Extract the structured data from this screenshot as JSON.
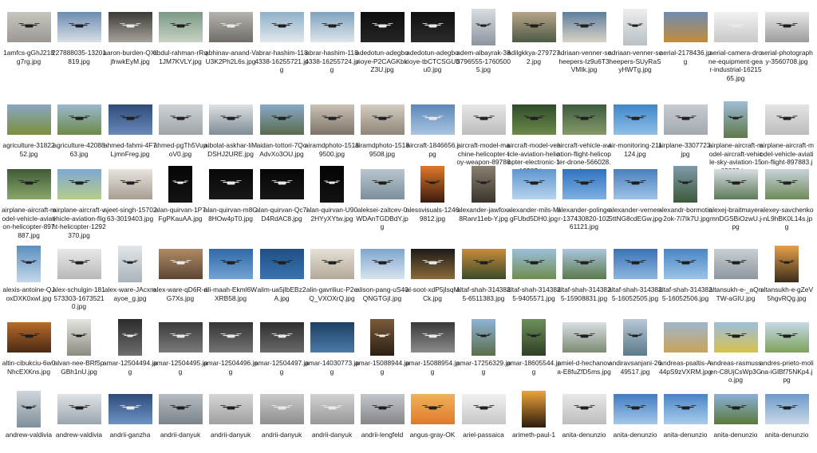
{
  "window": {
    "title": ""
  },
  "files": [
    {
      "name": "1amfcs-gGhJ218g7rg.jpg",
      "orient": "land",
      "bg": [
        "#c9c6c0",
        "#9b9792"
      ],
      "drone": true,
      "dark": true
    },
    {
      "name": "227888035-13201819.jpg",
      "orient": "land",
      "bg": [
        "#6b8cb0",
        "#d8dfe6"
      ],
      "drone": true,
      "dark": true
    },
    {
      "name": "aaron-burden-QXIjfnwkEyM.jpg",
      "orient": "land",
      "bg": [
        "#3d3a35",
        "#a7a39c"
      ],
      "drone": true,
      "dark": false
    },
    {
      "name": "abdul-rahman-rRq1JM7KVLY.jpg",
      "orient": "land",
      "bg": [
        "#7a9a86",
        "#c8d2c2"
      ],
      "drone": true,
      "dark": true
    },
    {
      "name": "abhinav-anand-VU3K2Ph2L6s.jpg",
      "orient": "land",
      "bg": [
        "#b6b3ae",
        "#6f6c68"
      ],
      "drone": true,
      "dark": false
    },
    {
      "name": "abrar-hashim-1184338-16255721.jpg",
      "orient": "land",
      "bg": [
        "#8fb1c9",
        "#e1e7ea"
      ],
      "drone": true,
      "dark": true
    },
    {
      "name": "abrar-hashim-1184338-16255724.jpg",
      "orient": "land",
      "bg": [
        "#7fa2bf",
        "#dfe6eb"
      ],
      "drone": true,
      "dark": true
    },
    {
      "name": "adedotun-adegborioye-P2CAGKbkZ3U.jpg",
      "orient": "land",
      "bg": [
        "#0d0d0d",
        "#262626"
      ],
      "drone": true,
      "dark": false
    },
    {
      "name": "adedotun-adegborioye-tbCTCSGUbu0.jpg",
      "orient": "land",
      "bg": [
        "#101010",
        "#2b2b2b"
      ],
      "drone": true,
      "dark": false
    },
    {
      "name": "adem-albayrak-383796555-17605005.jpg",
      "orient": "port",
      "bg": [
        "#d9dde2",
        "#8d959e"
      ],
      "drone": true,
      "dark": true
    },
    {
      "name": "adilgkkya-2797272.jpg",
      "orient": "land",
      "bg": [
        "#b7a48a",
        "#4d5a44"
      ],
      "drone": true,
      "dark": true
    },
    {
      "name": "adriaan-venner-scheepers-Iz9u6T3VMIk.jpg",
      "orient": "land",
      "bg": [
        "#5e7f9e",
        "#d9d2c4"
      ],
      "drone": true,
      "dark": true
    },
    {
      "name": "adriaan-venner-scheepers-SUyRaSyHWTg.jpg",
      "orient": "port",
      "bg": [
        "#eceeef",
        "#b9bfc4"
      ],
      "drone": true,
      "dark": true
    },
    {
      "name": "aerial-2178436.jpg",
      "orient": "land",
      "bg": [
        "#6e8db0",
        "#c48a3c"
      ],
      "drone": false,
      "dark": true
    },
    {
      "name": "aerial-camera-drone-equipment-gear-industrial-1621565.jpg",
      "orient": "land",
      "bg": [
        "#f2f2f2",
        "#c8c8c8"
      ],
      "drone": true,
      "dark": false
    },
    {
      "name": "aerial-photography-3560708.jpg",
      "orient": "land",
      "bg": [
        "#e8e8e8",
        "#9c9c9c"
      ],
      "drone": true,
      "dark": true
    },
    {
      "name": "agriculture-3182252.jpg",
      "orient": "land",
      "bg": [
        "#8aa7c4",
        "#7a8f3a"
      ],
      "drone": false,
      "dark": true
    },
    {
      "name": "agriculture-4208863.jpg",
      "orient": "land",
      "bg": [
        "#9bb8d0",
        "#6c8a48"
      ],
      "drone": true,
      "dark": true
    },
    {
      "name": "ahmed-fahmi-4F7LjmnFreg.jpg",
      "orient": "land",
      "bg": [
        "#2e4a7a",
        "#6a8ab8"
      ],
      "drone": true,
      "dark": true
    },
    {
      "name": "ahmed-pgTh5VupoV0.jpg",
      "orient": "land",
      "bg": [
        "#cfd3d6",
        "#9ea4a8"
      ],
      "drone": true,
      "dark": true
    },
    {
      "name": "aibolat-askhar-liMDSHJ2URE.jpg",
      "orient": "land",
      "bg": [
        "#dde1e4",
        "#7f8c95"
      ],
      "drone": true,
      "dark": true
    },
    {
      "name": "aidan-tottori-7QoAdvXo3OU.jpg",
      "orient": "land",
      "bg": [
        "#89a9c6",
        "#596b4d"
      ],
      "drone": true,
      "dark": true
    },
    {
      "name": "airamdphoto-15189500.jpg",
      "orient": "land",
      "bg": [
        "#c9c2b5",
        "#7d7467"
      ],
      "drone": true,
      "dark": true
    },
    {
      "name": "airamdphoto-15189508.jpg",
      "orient": "land",
      "bg": [
        "#d4cdc2",
        "#8f8578"
      ],
      "drone": true,
      "dark": true
    },
    {
      "name": "aircraft-1846656.jpg",
      "orient": "land",
      "bg": [
        "#5c87b8",
        "#a9c5e0"
      ],
      "drone": true,
      "dark": false
    },
    {
      "name": "aircraft-model-machine-helicopter-toy-weapon-897881.jpg",
      "orient": "land",
      "bg": [
        "#e6e6e6",
        "#bdbdbd"
      ],
      "drone": true,
      "dark": true
    },
    {
      "name": "aircraft-model-vehicle-aviation-helicopter-electronic-112587.jpg",
      "orient": "land",
      "bg": [
        "#2f4a2a",
        "#6c8a4b"
      ],
      "drone": true,
      "dark": true
    },
    {
      "name": "aircraft-vehicle-aviation-flight-helicopter-drone-566028.jpg",
      "orient": "land",
      "bg": [
        "#3b5b3b",
        "#869a6b"
      ],
      "drone": true,
      "dark": true
    },
    {
      "name": "air-monitoring-211124.jpg",
      "orient": "land",
      "bg": [
        "#3f86c9",
        "#8fc0e8"
      ],
      "drone": true,
      "dark": true
    },
    {
      "name": "airplane-3307723.jpg",
      "orient": "land",
      "bg": [
        "#c7ccd1",
        "#a2a9b0"
      ],
      "drone": true,
      "dark": true
    },
    {
      "name": "airplane-aircraft-model-aircraft-vehicle-sky-aviation-1505329.jpg",
      "orient": "port",
      "bg": [
        "#9fbcd6",
        "#5e7a4a"
      ],
      "drone": true,
      "dark": true
    },
    {
      "name": "airplane-aircraft-model-vehicle-aviation-flight-897883.jpg",
      "orient": "land",
      "bg": [
        "#e5e5e5",
        "#bcbcbc"
      ],
      "drone": true,
      "dark": true
    },
    {
      "name": "airplane-aircraft-model-vehicle-aviation-helicopter-897887.jpg",
      "orient": "land",
      "bg": [
        "#405a36",
        "#8aa76b"
      ],
      "drone": true,
      "dark": true
    },
    {
      "name": "airplane-aircraft-vehicle-aviation-flight-helicopter-1292370.jpg",
      "orient": "land",
      "bg": [
        "#7ea8d4",
        "#b5cc8a"
      ],
      "drone": true,
      "dark": true
    },
    {
      "name": "ajeet-singh-1570263-3019403.jpg",
      "orient": "land",
      "bg": [
        "#e8e4de",
        "#a79e92"
      ],
      "drone": true,
      "dark": true
    },
    {
      "name": "alan-quirvan-1P7FgPKauAA.jpg",
      "orient": "port",
      "bg": [
        "#050505",
        "#141414"
      ],
      "drone": true,
      "dark": false
    },
    {
      "name": "alan-quirvan-m8C8HOw4pT0.jpg",
      "orient": "land",
      "bg": [
        "#070707",
        "#191919"
      ],
      "drone": true,
      "dark": false
    },
    {
      "name": "alan-quirvan-Qc7iD4RdAC8.jpg",
      "orient": "land",
      "bg": [
        "#060606",
        "#171717"
      ],
      "drone": true,
      "dark": false
    },
    {
      "name": "alan-quirvan-U902HYyXYtw.jpg",
      "orient": "port",
      "bg": [
        "#040404",
        "#121212"
      ],
      "drone": true,
      "dark": false
    },
    {
      "name": "aleksei-zaitcev-0WDAnTGDBdY.jpg",
      "orient": "land",
      "bg": [
        "#b9c6d0",
        "#7d8f9c"
      ],
      "drone": true,
      "dark": true
    },
    {
      "name": "alessvisuals-12469812.jpg",
      "orient": "port",
      "bg": [
        "#e0782a",
        "#3a1c0e"
      ],
      "drone": true,
      "dark": true
    },
    {
      "name": "alexander-jawfox-8Ranr11eb-Y.jpg",
      "orient": "port",
      "bg": [
        "#8a8070",
        "#3a342b"
      ],
      "drone": true,
      "dark": true
    },
    {
      "name": "alexander-mils-MIgFUbd5DH0.jpg",
      "orient": "land",
      "bg": [
        "#5f95cf",
        "#b8d4ee"
      ],
      "drone": true,
      "dark": true
    },
    {
      "name": "alexander-polinger-137430820-10261121.jpg",
      "orient": "land",
      "bg": [
        "#2f73bf",
        "#7fb0e3"
      ],
      "drone": true,
      "dark": true
    },
    {
      "name": "alexander-verner-SttNG8cdEGw.jpg",
      "orient": "land",
      "bg": [
        "#4a80bd",
        "#9ec3e6"
      ],
      "drone": true,
      "dark": true
    },
    {
      "name": "alexandr-bormotin-2ok-7i7Ik7U.jpg",
      "orient": "port",
      "bg": [
        "#7f9aa8",
        "#3d5a3c"
      ],
      "drone": true,
      "dark": true
    },
    {
      "name": "alexej-braitmayer-mnDGSBiOzwU.jpg",
      "orient": "land",
      "bg": [
        "#d7dde1",
        "#5e7a5a"
      ],
      "drone": true,
      "dark": true
    },
    {
      "name": "alexey-savchenko-nL9hBK0L14s.jpg",
      "orient": "land",
      "bg": [
        "#c8d3dc",
        "#6f8b57"
      ],
      "drone": true,
      "dark": true
    },
    {
      "name": "alexis-antoine-QJoxDXK0xwI.jpg",
      "orient": "port",
      "bg": [
        "#5a8fc0",
        "#c5d9ea"
      ],
      "drone": true,
      "dark": true
    },
    {
      "name": "alex-schulgin-181573303-16735210.jpg",
      "orient": "land",
      "bg": [
        "#e8e8e8",
        "#b9b9b9"
      ],
      "drone": true,
      "dark": true
    },
    {
      "name": "alex-ware-JAcxmayoe_g.jpg",
      "orient": "port",
      "bg": [
        "#e2e6e9",
        "#aab4bb"
      ],
      "drone": true,
      "dark": true
    },
    {
      "name": "alex-ware-qD6R-rlG7Xs.jpg",
      "orient": "land",
      "bg": [
        "#b08a64",
        "#5d4634"
      ],
      "drone": true,
      "dark": false
    },
    {
      "name": "ali-maah-Ekml6WXRB58.jpg",
      "orient": "land",
      "bg": [
        "#2f69a8",
        "#73a3d4"
      ],
      "drone": true,
      "dark": true
    },
    {
      "name": "alim-ua5jIbEBz2A.jpg",
      "orient": "land",
      "bg": [
        "#1f4f86",
        "#3b73b0"
      ],
      "drone": true,
      "dark": true
    },
    {
      "name": "alin-gavriliuc-P2eQ_VXOXrQ.jpg",
      "orient": "land",
      "bg": [
        "#e6e0d6",
        "#b3a998"
      ],
      "drone": true,
      "dark": true
    },
    {
      "name": "alison-pang-uS40QNGTGjI.jpg",
      "orient": "land",
      "bg": [
        "#7ea6cf",
        "#d9e4ee"
      ],
      "drone": true,
      "dark": true
    },
    {
      "name": "al-soot-xdP5jIsqMCk.jpg",
      "orient": "land",
      "bg": [
        "#1d1b18",
        "#8a6a3b"
      ],
      "drone": true,
      "dark": false
    },
    {
      "name": "altaf-shah-3143825-6511383.jpg",
      "orient": "land",
      "bg": [
        "#c98d3a",
        "#3a4a2a"
      ],
      "drone": true,
      "dark": true
    },
    {
      "name": "altaf-shah-3143825-9405571.jpg",
      "orient": "land",
      "bg": [
        "#9bbfdc",
        "#6e8d4f"
      ],
      "drone": true,
      "dark": true
    },
    {
      "name": "altaf-shah-3143825-15908831.jpg",
      "orient": "land",
      "bg": [
        "#a9c6df",
        "#5c7a4a"
      ],
      "drone": true,
      "dark": true
    },
    {
      "name": "altaf-shah-3143825-16052505.jpg",
      "orient": "land",
      "bg": [
        "#3a73b6",
        "#8db6de"
      ],
      "drone": true,
      "dark": true
    },
    {
      "name": "altaf-shah-3143825-16052506.jpg",
      "orient": "land",
      "bg": [
        "#4a86c4",
        "#9cc3e7"
      ],
      "drone": true,
      "dark": true
    },
    {
      "name": "altansukh-e-_aQnTW-aGIU.jpg",
      "orient": "land",
      "bg": [
        "#c9cfd4",
        "#8d979f"
      ],
      "drone": true,
      "dark": true
    },
    {
      "name": "altansukh-e-gZeV5hgvRQg.jpg",
      "orient": "port",
      "bg": [
        "#e6a04a",
        "#3a2d1c"
      ],
      "drone": true,
      "dark": true
    },
    {
      "name": "altin-cibukciu-6w0NhcEXKns.jpg",
      "orient": "land",
      "bg": [
        "#b86b2a",
        "#4a2a14"
      ],
      "drone": true,
      "dark": true
    },
    {
      "name": "alvan-nee-BRf5pGBh1nU.jpg",
      "orient": "port",
      "bg": [
        "#e4e4e0",
        "#8d8a80"
      ],
      "drone": true,
      "dark": true
    },
    {
      "name": "amar-12504494.jpg",
      "orient": "port",
      "bg": [
        "#2b2b2b",
        "#6e6e6e"
      ],
      "drone": true,
      "dark": false
    },
    {
      "name": "amar-12504495.jpg",
      "orient": "land",
      "bg": [
        "#3a3a3a",
        "#7b7b7b"
      ],
      "drone": true,
      "dark": false
    },
    {
      "name": "amar-12504496.jpg",
      "orient": "land",
      "bg": [
        "#343434",
        "#747474"
      ],
      "drone": true,
      "dark": false
    },
    {
      "name": "amar-12504497.jpg",
      "orient": "land",
      "bg": [
        "#2f2f2f",
        "#6a6a6a"
      ],
      "drone": true,
      "dark": false
    },
    {
      "name": "amar-14030773.jpg",
      "orient": "land",
      "bg": [
        "#1e3f63",
        "#4a7aa8"
      ],
      "drone": false,
      "dark": true
    },
    {
      "name": "amar-15088944.jpg",
      "orient": "port",
      "bg": [
        "#7a5a3a",
        "#2c1f14"
      ],
      "drone": true,
      "dark": false
    },
    {
      "name": "amar-15088954.jpg",
      "orient": "land",
      "bg": [
        "#3a3a3a",
        "#8b8b8b"
      ],
      "drone": true,
      "dark": false
    },
    {
      "name": "amar-17256329.jpg",
      "orient": "port",
      "bg": [
        "#8fb4d6",
        "#5a6d4a"
      ],
      "drone": true,
      "dark": true
    },
    {
      "name": "amar-18605544.jpg",
      "orient": "port",
      "bg": [
        "#6d8f5a",
        "#2f3f27"
      ],
      "drone": true,
      "dark": true
    },
    {
      "name": "amiel-d-hechanova-E8fuZfD5ms.jpg",
      "orient": "land",
      "bg": [
        "#d9dfe4",
        "#7d8b73"
      ],
      "drone": true,
      "dark": true
    },
    {
      "name": "andiravsanjani-2649517.jpg",
      "orient": "port",
      "bg": [
        "#b8c8d6",
        "#5a7a8a"
      ],
      "drone": true,
      "dark": true
    },
    {
      "name": "andreas-psaltis-A44pS9zVXRM.jpg",
      "orient": "land",
      "bg": [
        "#9fb6cb",
        "#c9a35a"
      ],
      "drone": false,
      "dark": true
    },
    {
      "name": "andreas-rasmussen-C8UjCsWp3Go.jpg",
      "orient": "land",
      "bg": [
        "#9cbfe0",
        "#d6c24a"
      ],
      "drone": true,
      "dark": true
    },
    {
      "name": "andres-prieto-molina-iGlBf75NKp4.jpg",
      "orient": "land",
      "bg": [
        "#c6d9ea",
        "#7da35a"
      ],
      "drone": true,
      "dark": true
    },
    {
      "name": "andrew-valdivia",
      "orient": "port",
      "bg": [
        "#cfd6dc",
        "#7f8f9a"
      ],
      "drone": true,
      "dark": true
    },
    {
      "name": "andrew-valdivia",
      "orient": "land",
      "bg": [
        "#dfe3e6",
        "#9aa6ae"
      ],
      "drone": true,
      "dark": true
    },
    {
      "name": "andrii-ganzha",
      "orient": "land",
      "bg": [
        "#2d4c7c",
        "#6e93c4"
      ],
      "drone": true,
      "dark": false
    },
    {
      "name": "andrii-danyuk",
      "orient": "land",
      "bg": [
        "#b5bcc2",
        "#7b848b"
      ],
      "drone": true,
      "dark": true
    },
    {
      "name": "andrii-danyuk",
      "orient": "land",
      "bg": [
        "#d6d6d6",
        "#a0a0a0"
      ],
      "drone": true,
      "dark": true
    },
    {
      "name": "andrii-danyuk",
      "orient": "land",
      "bg": [
        "#cacaca",
        "#8e8e8e"
      ],
      "drone": true,
      "dark": false
    },
    {
      "name": "andrii-danyuk",
      "orient": "land",
      "bg": [
        "#d2d2d2",
        "#979797"
      ],
      "drone": true,
      "dark": false
    },
    {
      "name": "andrii-lengfeld",
      "orient": "land",
      "bg": [
        "#c2c7cb",
        "#85878a"
      ],
      "drone": true,
      "dark": true
    },
    {
      "name": "angus-gray-OK",
      "orient": "land",
      "bg": [
        "#f0b25a",
        "#e07a2a"
      ],
      "drone": true,
      "dark": true
    },
    {
      "name": "ariel-passaica",
      "orient": "land",
      "bg": [
        "#f0f0f0",
        "#c8c8c8"
      ],
      "drone": true,
      "dark": true
    },
    {
      "name": "arimeth-paul-1",
      "orient": "port",
      "bg": [
        "#f0a43a",
        "#2a1a0c"
      ],
      "drone": false,
      "dark": true
    },
    {
      "name": "anita-denunzio",
      "orient": "land",
      "bg": [
        "#e8e8e8",
        "#bdbdbd"
      ],
      "drone": true,
      "dark": true
    },
    {
      "name": "anita-denunzio",
      "orient": "land",
      "bg": [
        "#3f7cc0",
        "#a5c8ea"
      ],
      "drone": true,
      "dark": true
    },
    {
      "name": "anita-denunzio",
      "orient": "land",
      "bg": [
        "#4a84c6",
        "#abcdec"
      ],
      "drone": true,
      "dark": true
    },
    {
      "name": "anita-denunzio",
      "orient": "land",
      "bg": [
        "#8bb0d8",
        "#5b7a3a"
      ],
      "drone": true,
      "dark": true
    },
    {
      "name": "anita-denunzio",
      "orient": "land",
      "bg": [
        "#6e9acc",
        "#c9d9e8"
      ],
      "drone": true,
      "dark": true
    }
  ]
}
